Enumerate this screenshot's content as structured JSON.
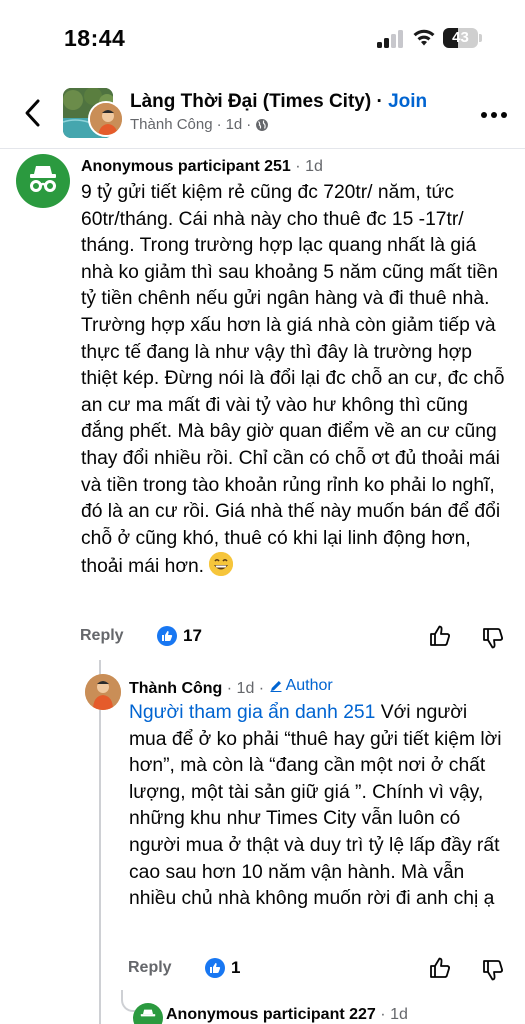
{
  "status": {
    "time": "18:44",
    "battery": "43",
    "battery_level_percent": 43
  },
  "header": {
    "group_name": "Làng Thời Đại (Times City)",
    "separator": "·",
    "join_label": "Join",
    "author": "Thành Công",
    "meta_dot": "·",
    "timestamp": "1d",
    "dot2": "·"
  },
  "comments": [
    {
      "name": "Anonymous participant 251",
      "dot": "·",
      "time": "1d",
      "text": "9 tỷ gửi tiết kiệm rẻ cũng đc 720tr/ năm, tức 60tr/tháng. Cái nhà này cho thuê đc 15 -17tr/ tháng. Trong trường hợp lạc quang nhất là giá nhà ko giảm thì sau khoảng 5 năm cũng mất tiền tỷ tiền chênh nếu gửi  ngân hàng và đi thuê nhà. Trường hợp xấu hơn là giá nhà còn giảm tiếp và thực tế đang là như vậy thì đây là trường hợp thiệt kép. Đừng nói là đổi lại đc chỗ an cư, đc chỗ an cư ma mất đi vài tỷ vào hư không thì cũng đắng phết. Mà bây giờ quan điểm về an cư cũng thay đổi nhiều rồi. Chỉ cần có chỗ ơt đủ thoải mái và tiền trong tào khoản rủng rỉnh ko phải lo nghĩ, đó là an cư rồi. Giá nhà thế này muốn bán để đổi chỗ ở cũng khó, thuê có khi lại linh động hơn, thoải mái hơn.",
      "reply_label": "Reply",
      "likes": "17"
    },
    {
      "name": "Thành Công",
      "dot": "·",
      "time": "1d",
      "dot2": "·",
      "badge": "Author",
      "mention": "Người tham gia ẩn danh 251",
      "text": " Với người mua để ở ko phải “thuê hay gửi tiết kiệm lời hơn”, mà còn là “đang cần một nơi ở chất lượng, một tài sản giữ giá ”. Chính vì vậy, những khu như Times City vẫn luôn có người mua ở thật và duy trì tỷ lệ lấp đầy rất cao sau hơn 10 năm vận hành. Mà vẫn nhiều chủ nhà không muốn rời đi anh chị ạ",
      "reply_label": "Reply",
      "likes": "1"
    },
    {
      "name": "Anonymous participant 227",
      "dot": "·",
      "time": "1d"
    }
  ],
  "colors": {
    "link": "#0064d1",
    "secondary_text": "#65676b",
    "like_blue": "#1877f2",
    "anon_green": "#2b9a3f"
  }
}
